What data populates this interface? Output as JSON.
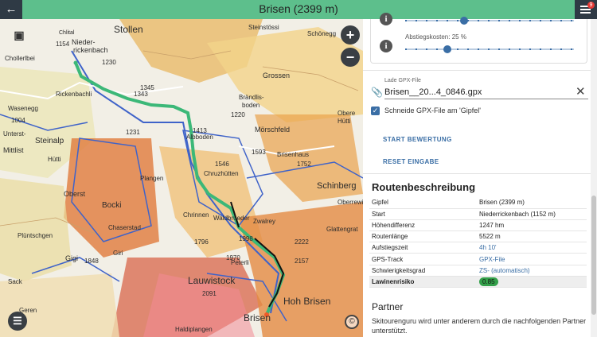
{
  "header": {
    "title": "Brisen (2399 m)",
    "back_icon": "arrow-left-icon",
    "menu_icon": "menu-icon",
    "notification_count": "9"
  },
  "map": {
    "labels": [
      {
        "text": "Stollen"
      },
      {
        "text": "Nieder-"
      },
      {
        "text": "rickenbach"
      },
      {
        "text": "Chlital"
      },
      {
        "text": "1154"
      },
      {
        "text": "1230"
      },
      {
        "text": "Chollerlbei"
      },
      {
        "text": "1343"
      },
      {
        "text": "Rickenbachli"
      },
      {
        "text": "1345"
      },
      {
        "text": "Wasenegg"
      },
      {
        "text": "1004"
      },
      {
        "text": "Unterst-"
      },
      {
        "text": "Steinalp"
      },
      {
        "text": "Mittlist"
      },
      {
        "text": "Hütti"
      },
      {
        "text": "1413"
      },
      {
        "text": "Albboden"
      },
      {
        "text": "1593"
      },
      {
        "text": "Brisenhaus"
      },
      {
        "text": "1752"
      },
      {
        "text": "Schinberg"
      },
      {
        "text": "Oberst"
      },
      {
        "text": "Bocki"
      },
      {
        "text": "Plüntschgen"
      },
      {
        "text": "Chaserstad"
      },
      {
        "text": "1796"
      },
      {
        "text": "Gigi"
      },
      {
        "text": "1848"
      },
      {
        "text": "Giri"
      },
      {
        "text": "1998"
      },
      {
        "text": "2157"
      },
      {
        "text": "2222"
      },
      {
        "text": "Lauwistock"
      },
      {
        "text": "2091"
      },
      {
        "text": "Hoh Brisen"
      },
      {
        "text": "Brisen"
      },
      {
        "text": "Sack"
      },
      {
        "text": "Geren"
      },
      {
        "text": "Steinstössi"
      },
      {
        "text": "Schönegg"
      },
      {
        "text": "Grossen"
      },
      {
        "text": "Brändlis-"
      },
      {
        "text": "boden"
      },
      {
        "text": "Mörschfeld"
      },
      {
        "text": "Obere"
      },
      {
        "text": "Hütti"
      },
      {
        "text": "Waldbrueder"
      },
      {
        "text": "Peterli"
      },
      {
        "text": "Zwalrey"
      },
      {
        "text": "Plangen"
      },
      {
        "text": "1546"
      },
      {
        "text": "Chruzhütten"
      },
      {
        "text": "1220"
      },
      {
        "text": "1231"
      },
      {
        "text": "Chrinnen"
      },
      {
        "text": "Haldiplangen"
      },
      {
        "text": "Glattengrat"
      },
      {
        "text": "Oberrewil"
      },
      {
        "text": "1970"
      }
    ],
    "controls": {
      "zoom_in": "+",
      "zoom_out": "−",
      "map_icon": "map-search-icon",
      "layers_icon": "layers-icon",
      "copyright": "©"
    }
  },
  "panel": {
    "slider1": {
      "value_fraction": 0.35
    },
    "slider2": {
      "label": "Abstiegskosten: 25 %",
      "value_fraction": 0.25
    },
    "gpx": {
      "label": "Lade GPX-File",
      "value": "Brisen__20...4_0846.gpx",
      "clear_icon": "close-icon",
      "attach_icon": "paperclip-icon"
    },
    "cut_checkbox": {
      "label": "Schneide GPX-File am 'Gipfel'",
      "checked": true
    },
    "buttons": {
      "start": "START BEWERTUNG",
      "reset": "RESET EINGABE"
    },
    "route": {
      "title": "Routenbeschreibung",
      "rows": [
        {
          "key": "Gipfel",
          "value": "Brisen (2399 m)"
        },
        {
          "key": "Start",
          "value": "Niederrickenbach (1152 m)"
        },
        {
          "key": "Höhendifferenz",
          "value": "1247 hm"
        },
        {
          "key": "Routenlänge",
          "value": "5522 m"
        },
        {
          "key": "Aufstiegszeit",
          "value": "4h 10'"
        },
        {
          "key": "GPS-Track",
          "value": "GPX-File"
        },
        {
          "key": "Schwierigkeitsgrad",
          "value": "ZS- (automatisch)"
        },
        {
          "key": "Lawinenrisiko",
          "value": "0.85"
        }
      ]
    },
    "partner": {
      "title": "Partner",
      "text": "Skitourenguru wird unter anderem durch die nachfolgenden Partner unterstützt."
    }
  },
  "colors": {
    "header": "#5dbf8c",
    "accent": "#3a6ea5",
    "track": "#3cb878",
    "risk": "#33a04a"
  }
}
